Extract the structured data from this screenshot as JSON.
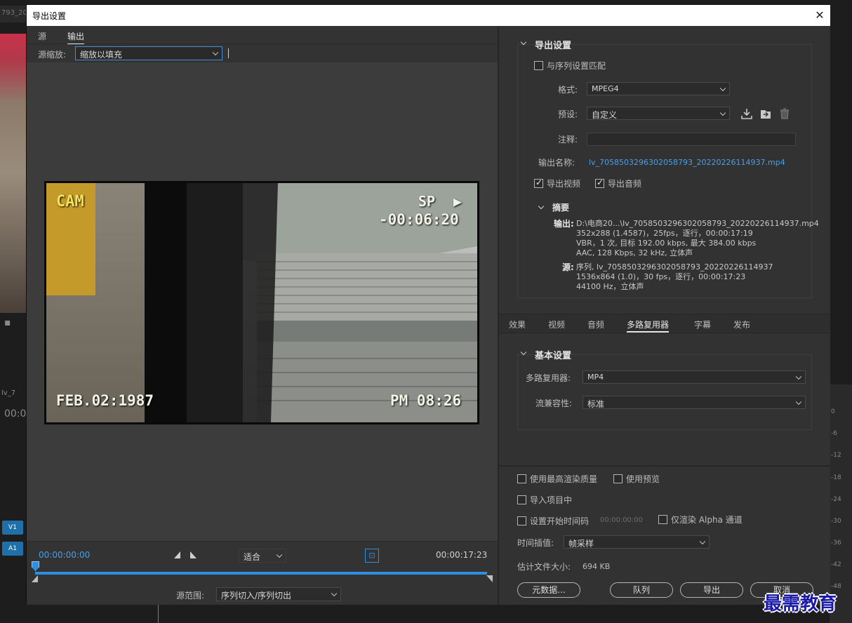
{
  "background": {
    "tab_label": "793_20",
    "track_v1": "V1",
    "track_a1": "A1",
    "seq_label": "lv_7",
    "seq_time": "00:0",
    "meter_labels": [
      "0",
      "-6",
      "-12",
      "-18",
      "-24",
      "-30",
      "-36",
      "-42",
      "-48"
    ]
  },
  "dialog": {
    "title": "导出设置",
    "close_glyph": "✕"
  },
  "left": {
    "tabs": [
      "源",
      "输出"
    ],
    "active_tab": 1,
    "source_scale_label": "源缩放:",
    "source_scale_value": "缩放以填充",
    "video_overlay": {
      "cam": "CAM",
      "sp": "SP",
      "counter": "-00:06:20",
      "date": "FEB.02:1987",
      "time": "PM 08:26"
    },
    "timeline": {
      "start_tc": "00:00:00:00",
      "end_tc": "00:00:17:23",
      "fit_value": "适合",
      "source_range_label": "源范围:",
      "source_range_value": "序列切入/序列切出",
      "playhead_fraction": 0.0
    }
  },
  "right": {
    "export_settings": {
      "title": "导出设置",
      "match_sequence": "与序列设置匹配",
      "match_checked": false,
      "format_label": "格式:",
      "format_value": "MPEG4",
      "preset_label": "预设:",
      "preset_value": "自定义",
      "comment_label": "注释:",
      "comment_value": "",
      "output_name_label": "输出名称:",
      "output_name_value": "lv_7058503296302058793_20220226114937.mp4",
      "export_video": "导出视频",
      "export_video_checked": true,
      "export_audio": "导出音频",
      "export_audio_checked": true
    },
    "summary": {
      "title": "摘要",
      "output_key": "输出:",
      "output_lines": [
        "D:\\电商20...\\lv_7058503296302058793_20220226114937.mp4",
        "352x288 (1.4587)，25fps，逐行，00:00:17:19",
        "VBR，1 次, 目标 192.00 kbps, 最大 384.00 kbps",
        "AAC, 128 Kbps, 32  kHz, 立体声"
      ],
      "source_key": "源:",
      "source_lines": [
        "序列, lv_7058503296302058793_20220226114937",
        "1536x864 (1.0)，30 fps，逐行，00:00:17:23",
        "44100 Hz，立体声"
      ]
    },
    "tabs": [
      "效果",
      "视频",
      "音频",
      "多路复用器",
      "字幕",
      "发布"
    ],
    "active_tab": 3,
    "basic_settings": {
      "title": "基本设置",
      "multiplexer_label": "多路复用器:",
      "multiplexer_value": "MP4",
      "stream_compat_label": "流兼容性:",
      "stream_compat_value": "标准"
    },
    "lower": {
      "max_render_quality": "使用最高渲染质量",
      "use_previews": "使用预览",
      "import_into_project": "导入项目中",
      "set_start_tc": "设置开始时间码",
      "start_tc_value": "00:00:00:00",
      "render_alpha": "仅渲染 Alpha 通道",
      "time_interp_label": "时间插值:",
      "time_interp_value": "帧采样",
      "est_size_label": "估计文件大小:",
      "est_size_value": "694 KB",
      "btn_metadata": "元数据...",
      "btn_queue": "队列",
      "btn_export": "导出",
      "btn_cancel": "取消"
    }
  },
  "watermark": "最需教育"
}
